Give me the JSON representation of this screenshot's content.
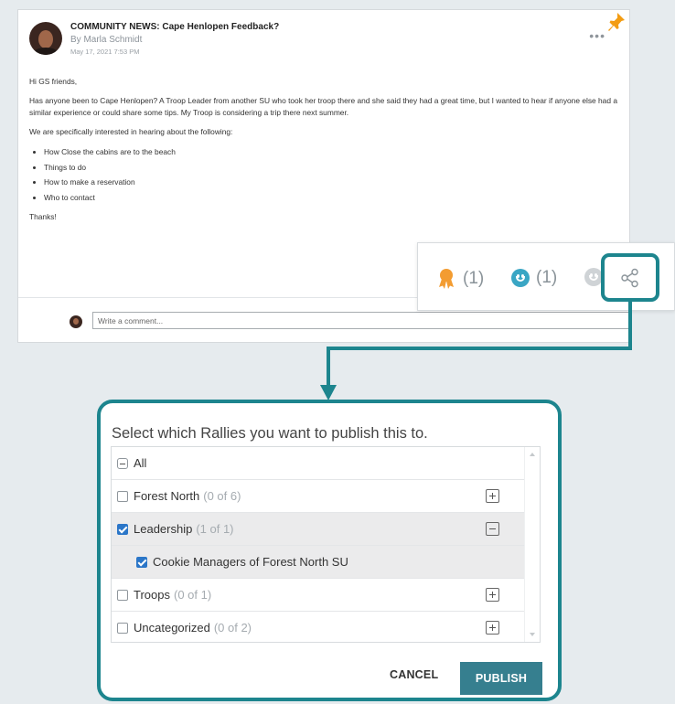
{
  "post": {
    "title": "COMMUNITY NEWS: Cape Henlopen Feedback?",
    "author": "By Marla Schmidt",
    "date": "May 17, 2021 7:53 PM",
    "more_label": "•••",
    "greeting": "Hi GS friends,",
    "paragraph1": "Has anyone been to Cape Henlopen? A Troop Leader from another SU who took her troop there and she said they had a great time, but I wanted to hear if anyone else had a similar experience or could share some tips. My Troop is considering a trip there next summer.",
    "paragraph2": "We are specifically interested in hearing about the following:",
    "bullets": [
      "How Close the cabins are to the beach",
      "Things to do",
      "How to make a reservation",
      "Who to contact"
    ],
    "signoff": "Thanks!",
    "comment_placeholder": "Write a comment..."
  },
  "reactions": {
    "award_count": "(1)",
    "smile_count": "(1)",
    "award_color": "#f39c31",
    "smile_active_color": "#3aa6c4",
    "smile_inactive_color": "#cfd3d6",
    "icons": [
      "award-icon",
      "smile-icon",
      "smile-icon",
      "share-icon"
    ]
  },
  "dialog": {
    "title": "Select which Rallies you want to publish this to.",
    "items": [
      {
        "label": "All",
        "count": ""
      },
      {
        "label": "Forest North",
        "count": "(0 of 6)"
      },
      {
        "label": "Leadership",
        "count": "(1 of 1)"
      },
      {
        "label": "Cookie Managers of Forest North SU",
        "count": ""
      },
      {
        "label": "Troops",
        "count": "(0 of 1)"
      },
      {
        "label": "Uncategorized",
        "count": "(0 of 2)"
      }
    ],
    "cancel_label": "CANCEL",
    "publish_label": "PUBLISH"
  },
  "colors": {
    "accent": "#1d858e",
    "publish": "#367f8f",
    "pin": "#f39c12",
    "checkbox": "#2b76c8"
  }
}
